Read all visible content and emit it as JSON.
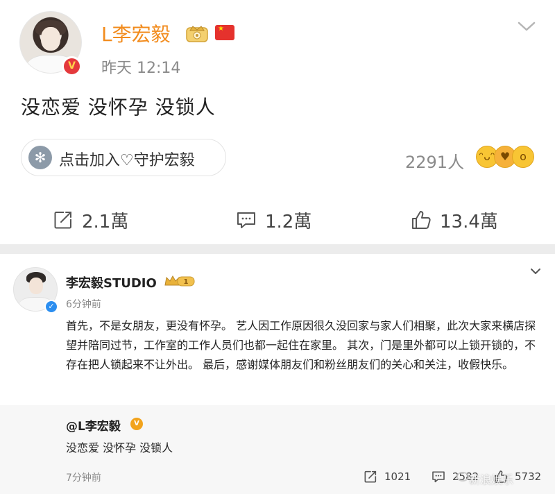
{
  "post1": {
    "username": "L李宏毅",
    "time": "昨天 12:14",
    "content": "没恋爱 没怀孕 没锁人",
    "join_button_label": "点击加入♡守护宏毅",
    "supporters_count": "2291人",
    "actions": {
      "repost": "2.1萬",
      "comment": "1.2萬",
      "like": "13.4萬"
    },
    "icons": [
      "chevron-down-icon",
      "crown-badge-icon",
      "china-flag-icon",
      "repost-icon",
      "comment-icon",
      "like-icon"
    ]
  },
  "post2": {
    "username": "李宏毅STUDIO",
    "crown_level": "1",
    "time": "6分钟前",
    "content": "首先，不是女朋友，更没有怀孕。 艺人因工作原因很久没回家与家人们相聚，此次大家来横店探望并陪同过节，工作室的工作人员们也都一起住在家里。 其次，门是里外都可以上锁开锁的，不存在把人锁起来不让外出。 最后，感谢媒体朋友们和粉丝朋友们的关心和关注，收假快乐。",
    "repost": {
      "username": "@L李宏毅",
      "content": "没恋爱 没怀孕 没锁人",
      "time": "7分钟前",
      "repost_count": "1021",
      "comment_count": "2582",
      "like_count": "5732"
    },
    "watermark": "新浪娱乐"
  },
  "colors": {
    "username_orange": "#f28b1c",
    "verified_red": "#e4393c",
    "verified_blue": "#2b8ef0",
    "separator": "#ececec",
    "repost_bg": "#f7f7f7"
  }
}
